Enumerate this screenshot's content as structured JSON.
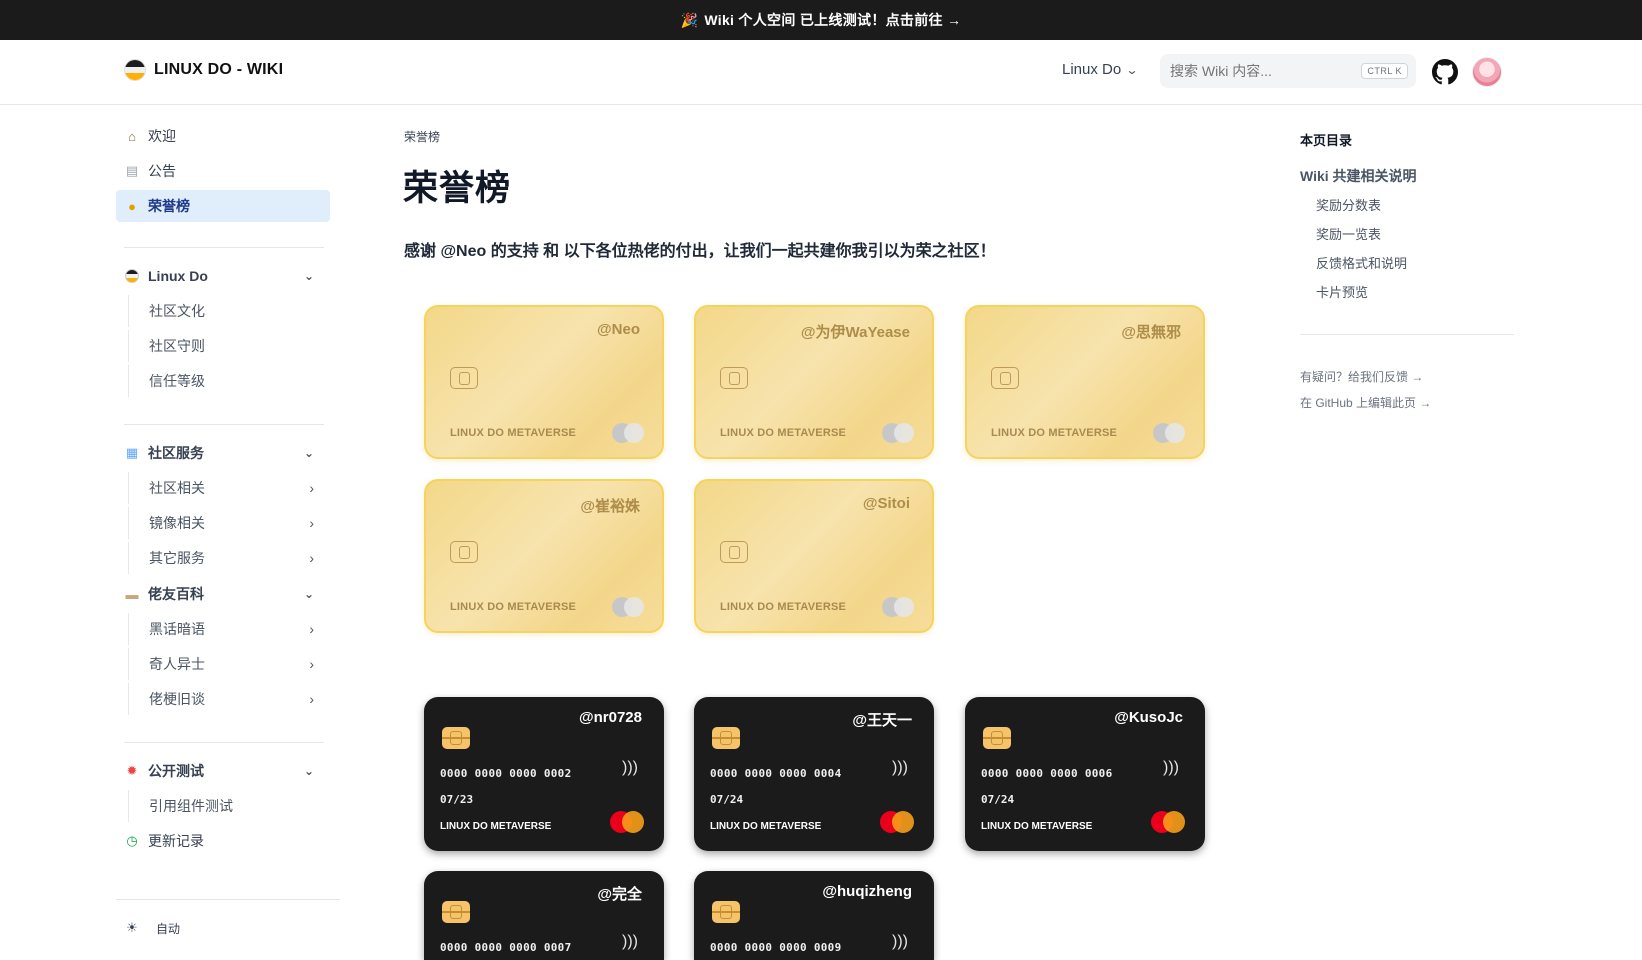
{
  "banner": {
    "party_icon": "🎉",
    "text": "Wiki 个人空间 已上线测试！点击前往 →"
  },
  "header": {
    "logo_text": "LINUX DO - WIKI",
    "dropdown_label": "Linux Do",
    "search_placeholder": "搜索 Wiki 内容...",
    "search_shortcut": "CTRL K"
  },
  "sidebar": {
    "top": [
      {
        "label": "欢迎",
        "icon": "house-icon"
      },
      {
        "label": "公告",
        "icon": "clipboard-icon"
      },
      {
        "label": "荣誉榜",
        "icon": "medal-icon",
        "active": true
      }
    ],
    "linuxdo": {
      "label": "Linux Do",
      "items": [
        "社区文化",
        "社区守则",
        "信任等级"
      ]
    },
    "services": {
      "label": "社区服务",
      "items": [
        "社区相关",
        "镜像相关",
        "其它服务"
      ]
    },
    "encyclopedia": {
      "label": "佬友百科",
      "items": [
        "黑话暗语",
        "奇人异士",
        "佬梗旧谈"
      ]
    },
    "public_test": {
      "label": "公开测试",
      "items": [
        "引用组件测试"
      ]
    },
    "changelog": "更新记录",
    "theme_label": "自动"
  },
  "main": {
    "breadcrumb": "荣誉榜",
    "title": "荣誉榜",
    "intro": "感谢 @Neo 的支持 和 以下各位热佬的付出，让我们一起共建你我引以为荣之社区！",
    "gold_brand": "LINUX DO METAVERSE",
    "gold_cards": [
      "@Neo",
      "@为伊WaYease",
      "@思無邪",
      "@崔裕姝",
      "@Sitoi"
    ],
    "dark_brand": "LINUX DO METAVERSE",
    "dark_cards": [
      {
        "name": "@nr0728",
        "number": "0000 0000 0000 0002",
        "expiry": "07/23"
      },
      {
        "name": "@王天一",
        "number": "0000 0000 0000 0004",
        "expiry": "07/24"
      },
      {
        "name": "@KusoJc",
        "number": "0000 0000 0000 0006",
        "expiry": "07/24"
      },
      {
        "name": "@完全",
        "number": "0000 0000 0000 0007",
        "expiry": ""
      },
      {
        "name": "@huqizheng",
        "number": "0000 0000 0000 0009",
        "expiry": ""
      }
    ]
  },
  "toc": {
    "title": "本页目录",
    "main": "Wiki 共建相关说明",
    "items": [
      "奖励分数表",
      "奖励一览表",
      "反馈格式和说明",
      "卡片预览"
    ],
    "feedback_link": "有疑问？给我们反馈 →",
    "edit_link": "在 GitHub 上编辑此页 →"
  }
}
